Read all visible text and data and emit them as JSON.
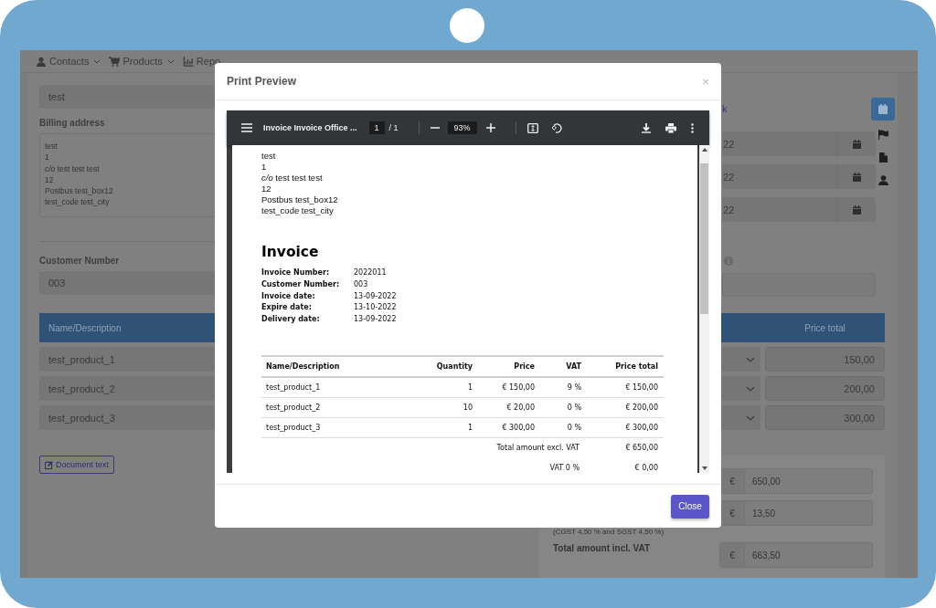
{
  "nav": [
    {
      "label": "Contacts",
      "kind": "person",
      "has_menu": true
    },
    {
      "label": "Products",
      "kind": "cart",
      "has_menu": true
    },
    {
      "label": "Repo",
      "kind": "chart",
      "has_menu": false
    }
  ],
  "form": {
    "name_value": "test",
    "billing_label": "Billing address",
    "billing_lines": [
      "test",
      "1",
      "*c/o* test test test",
      "12",
      "Postbus test_box12",
      "test_code test_city"
    ],
    "date_link": "k",
    "date_values": [
      "22",
      "22",
      "22"
    ],
    "customer_number_label": "Customer Number",
    "customer_number_value": "003"
  },
  "lines_table": {
    "columns": [
      "Name/Description",
      "Price total"
    ],
    "rows": [
      {
        "name": "test_product_1",
        "price_total": "150,00"
      },
      {
        "name": "test_product_2",
        "price_total": "200,00"
      },
      {
        "name": "test_product_3",
        "price_total": "300,00"
      }
    ]
  },
  "document_text_button": "Document text",
  "totals": {
    "currency": "€",
    "excl_value": "650,00",
    "vat_value": "13,50",
    "vat_note": "(CGST 4,50 % and SGST 4,50 %)",
    "incl_label": "Total amount incl. VAT",
    "incl_value": "663,50"
  },
  "sidebar": [
    {
      "kind": "calendar",
      "selected": true
    },
    {
      "kind": "flag",
      "selected": false
    },
    {
      "kind": "file",
      "selected": false
    },
    {
      "kind": "user",
      "selected": false
    }
  ],
  "modal": {
    "title": "Print Preview",
    "close": "×",
    "close_button": "Close",
    "viewer": {
      "document_title": "Invoice Invoice Office ...",
      "page": "1",
      "page_count": "/ 1",
      "zoom": "93%"
    },
    "document": {
      "address_lines": [
        "test",
        "1",
        "*c/o* test test test",
        "12",
        "Postbus test_box12",
        "test_code test_city"
      ],
      "heading": "Invoice",
      "details": [
        {
          "label": "Invoice Number:",
          "value": "2022011"
        },
        {
          "label": "Customer Number:",
          "value": "003"
        },
        {
          "label": "Invoice date:",
          "value": "13-09-2022"
        },
        {
          "label": "Expire date:",
          "value": "13-10-2022"
        },
        {
          "label": "Delivery date:",
          "value": "13-09-2022"
        }
      ],
      "table": {
        "columns": [
          "Name/Description",
          "Quantity",
          "Price",
          "VAT",
          "Price total"
        ],
        "rows": [
          [
            "test_product_1",
            "1",
            "€ 150,00",
            "9 %",
            "€ 150,00"
          ],
          [
            "test_product_2",
            "10",
            "€ 20,00",
            "0 %",
            "€ 200,00"
          ],
          [
            "test_product_3",
            "1",
            "€ 300,00",
            "0 %",
            "€ 300,00"
          ]
        ]
      },
      "totals": [
        {
          "label": "Total amount excl. VAT",
          "value": "€ 650,00"
        },
        {
          "label": "VAT 0 %",
          "value": "€ 0,00"
        }
      ]
    }
  }
}
